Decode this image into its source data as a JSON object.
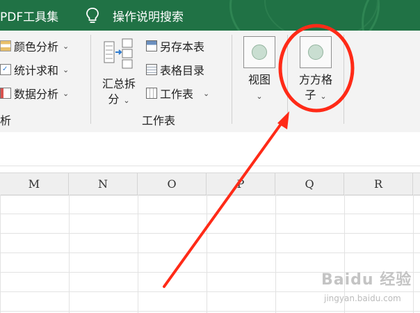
{
  "titlebar": {
    "tab_pdf": "PDF工具集",
    "search_label": "操作说明搜索"
  },
  "ribbon": {
    "analysis": {
      "items": [
        "颜色分析",
        "统计求和",
        "数据分析"
      ],
      "group_label": "析"
    },
    "worksheet": {
      "merge_split_line1": "汇总拆",
      "merge_split_line2": "分",
      "save_copy": "另存本表",
      "table_index": "表格目录",
      "worksheet_menu": "工作表",
      "group_label": "工作表"
    },
    "view": {
      "line1": "视图"
    },
    "grid_button": {
      "line1": "方方格",
      "line2": "子"
    }
  },
  "sheet": {
    "columns": [
      "M",
      "N",
      "O",
      "P",
      "Q",
      "R"
    ]
  },
  "watermark": {
    "main": "Baidu 经验",
    "sub": "jingyan.baidu.com"
  },
  "annotation_color": "#ff2a17"
}
